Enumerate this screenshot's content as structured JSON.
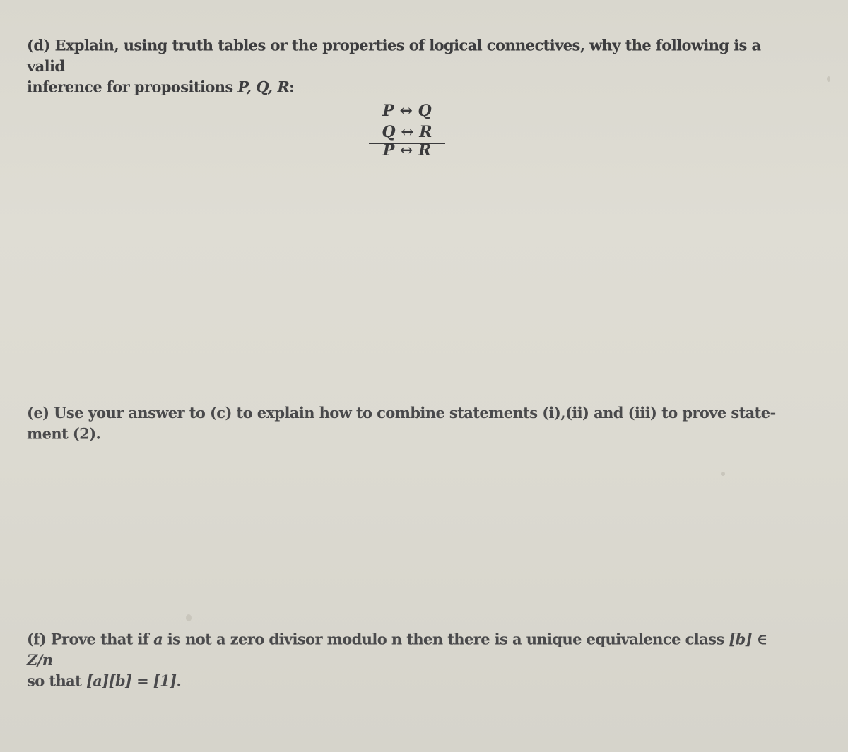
{
  "document": {
    "part_d": {
      "label": "(d)",
      "text_line1": "Explain, using truth tables or the properties of logical connectives, why the following is a valid",
      "text_line2_prefix": "inference for propositions ",
      "propositions": "P, Q, R",
      "text_line2_suffix": ":",
      "inference": {
        "premises": [
          "P ↔ Q",
          "Q ↔ R"
        ],
        "conclusion": "P ↔ R"
      }
    },
    "part_e": {
      "label": "(e)",
      "text_line1": "Use your answer to (c) to explain how to combine statements (i),(ii) and (iii) to prove state-",
      "text_line2": "ment (2)."
    },
    "part_f": {
      "label": "(f)",
      "text_line1_a": "Prove that if ",
      "var_a": "a",
      "text_line1_b": " is not a zero divisor modulo n then there is a unique equivalence class ",
      "class_b": "[b] ∈ Z/n",
      "text_line2_a": "so that ",
      "equation": "[a][b] = [1]",
      "text_line2_b": "."
    }
  }
}
